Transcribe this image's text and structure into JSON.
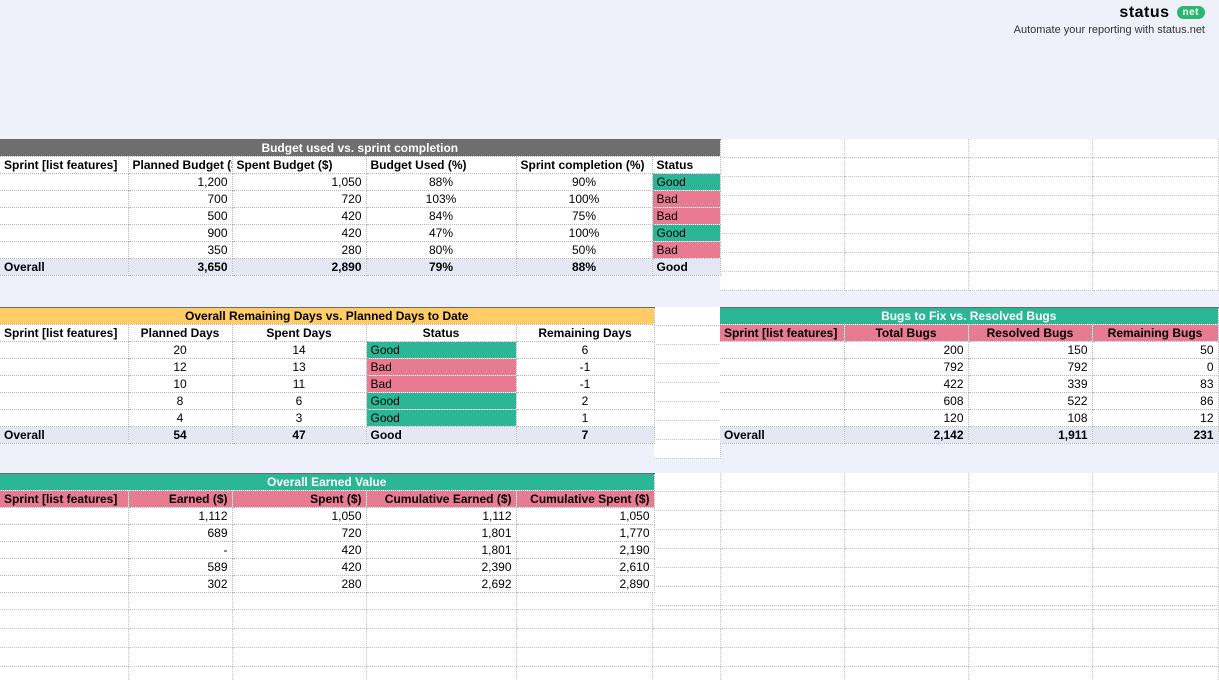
{
  "brand": {
    "name": "status",
    "pill": "net",
    "tagline": "Automate your reporting with status.net"
  },
  "budget": {
    "title": "Budget used vs. sprint completion",
    "headers": [
      "Sprint [list features]",
      "Planned Budget ($)",
      "Spent Budget ($)",
      "Budget Used (%)",
      "Sprint completion (%)",
      "Status"
    ],
    "rows": [
      {
        "sprint": "",
        "planned": "1,200",
        "spent": "1,050",
        "used": "88%",
        "comp": "90%",
        "status": "Good"
      },
      {
        "sprint": "",
        "planned": "700",
        "spent": "720",
        "used": "103%",
        "comp": "100%",
        "status": "Bad"
      },
      {
        "sprint": "",
        "planned": "500",
        "spent": "420",
        "used": "84%",
        "comp": "75%",
        "status": "Bad"
      },
      {
        "sprint": "",
        "planned": "900",
        "spent": "420",
        "used": "47%",
        "comp": "100%",
        "status": "Good"
      },
      {
        "sprint": "",
        "planned": "350",
        "spent": "280",
        "used": "80%",
        "comp": "50%",
        "status": "Bad"
      }
    ],
    "overall": {
      "label": "Overall",
      "planned": "3,650",
      "spent": "2,890",
      "used": "79%",
      "comp": "88%",
      "status": "Good"
    }
  },
  "days": {
    "title": "Overall Remaining Days vs. Planned Days to Date",
    "headers": [
      "Sprint [list features]",
      "Planned Days",
      "Spent Days",
      "Status",
      "Remaining Days"
    ],
    "rows": [
      {
        "sprint": "",
        "planned": "20",
        "spent": "14",
        "status": "Good",
        "remain": "6"
      },
      {
        "sprint": "",
        "planned": "12",
        "spent": "13",
        "status": "Bad",
        "remain": "-1"
      },
      {
        "sprint": "",
        "planned": "10",
        "spent": "11",
        "status": "Bad",
        "remain": "-1"
      },
      {
        "sprint": "",
        "planned": "8",
        "spent": "6",
        "status": "Good",
        "remain": "2"
      },
      {
        "sprint": "",
        "planned": "4",
        "spent": "3",
        "status": "Good",
        "remain": "1"
      }
    ],
    "overall": {
      "label": "Overall",
      "planned": "54",
      "spent": "47",
      "status": "Good",
      "remain": "7"
    }
  },
  "earned": {
    "title": "Overall Earned Value",
    "headers": [
      "Sprint [list features]",
      "Earned ($)",
      "Spent ($)",
      "Cumulative Earned ($)",
      "Cumulative Spent ($)"
    ],
    "rows": [
      {
        "sprint": "",
        "earned": "1,112",
        "spent": "1,050",
        "cume": "1,112",
        "cums": "1,050"
      },
      {
        "sprint": "",
        "earned": "689",
        "spent": "720",
        "cume": "1,801",
        "cums": "1,770"
      },
      {
        "sprint": "",
        "earned": "-",
        "spent": "420",
        "cume": "1,801",
        "cums": "2,190"
      },
      {
        "sprint": "",
        "earned": "589",
        "spent": "420",
        "cume": "2,390",
        "cums": "2,610"
      },
      {
        "sprint": "",
        "earned": "302",
        "spent": "280",
        "cume": "2,692",
        "cums": "2,890"
      }
    ]
  },
  "bugs": {
    "title": "Bugs to Fix vs. Resolved Bugs",
    "headers": [
      "Sprint [list features]",
      "Total Bugs",
      "Resolved Bugs",
      "Remaining Bugs"
    ],
    "rows": [
      {
        "sprint": "",
        "total": "200",
        "resolved": "150",
        "remain": "50"
      },
      {
        "sprint": "",
        "total": "792",
        "resolved": "792",
        "remain": "0"
      },
      {
        "sprint": "",
        "total": "422",
        "resolved": "339",
        "remain": "83"
      },
      {
        "sprint": "",
        "total": "608",
        "resolved": "522",
        "remain": "86"
      },
      {
        "sprint": "",
        "total": "120",
        "resolved": "108",
        "remain": "12"
      }
    ],
    "overall": {
      "label": "Overall",
      "total": "2,142",
      "resolved": "1,911",
      "remain": "231"
    }
  }
}
